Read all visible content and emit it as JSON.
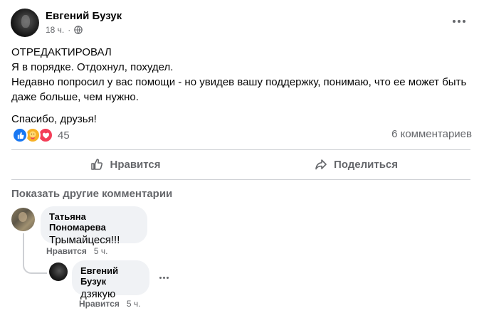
{
  "post": {
    "author": "Евгений Бузук",
    "time": "18 ч.",
    "privacy_icon": "globe-icon",
    "more_icon": "more-horizontal-icon",
    "text_lines": [
      "ОТРЕДАКТИРОВАЛ",
      "Я в порядке. Отдохнул, похудел.",
      "Недавно попросил у вас помощи - но увидев вашу поддержку, понимаю, что ее может быть",
      "даже больше, чем нужно."
    ],
    "thanks": "Спасибо, друзья!"
  },
  "stats": {
    "reaction_icons": [
      "like-icon",
      "care-icon",
      "love-icon"
    ],
    "reaction_count": "45",
    "comments_count": "6 комментариев"
  },
  "actions": {
    "like_label": "Нравится",
    "share_label": "Поделиться"
  },
  "comments": {
    "show_more": "Показать другие комментарии",
    "items": [
      {
        "author": "Татьяна Пономарева",
        "text": "Трымайцеся!!!",
        "like_label": "Нравится",
        "time": "5 ч."
      },
      {
        "author": "Евгений Бузук",
        "text": "дзякую",
        "like_label": "Нравится",
        "time": "5 ч."
      }
    ]
  },
  "colors": {
    "like": "#1877f2",
    "care": "#f7b125",
    "love": "#f33e58",
    "secondary_text": "#65676b",
    "bubble_bg": "#f0f2f5"
  }
}
